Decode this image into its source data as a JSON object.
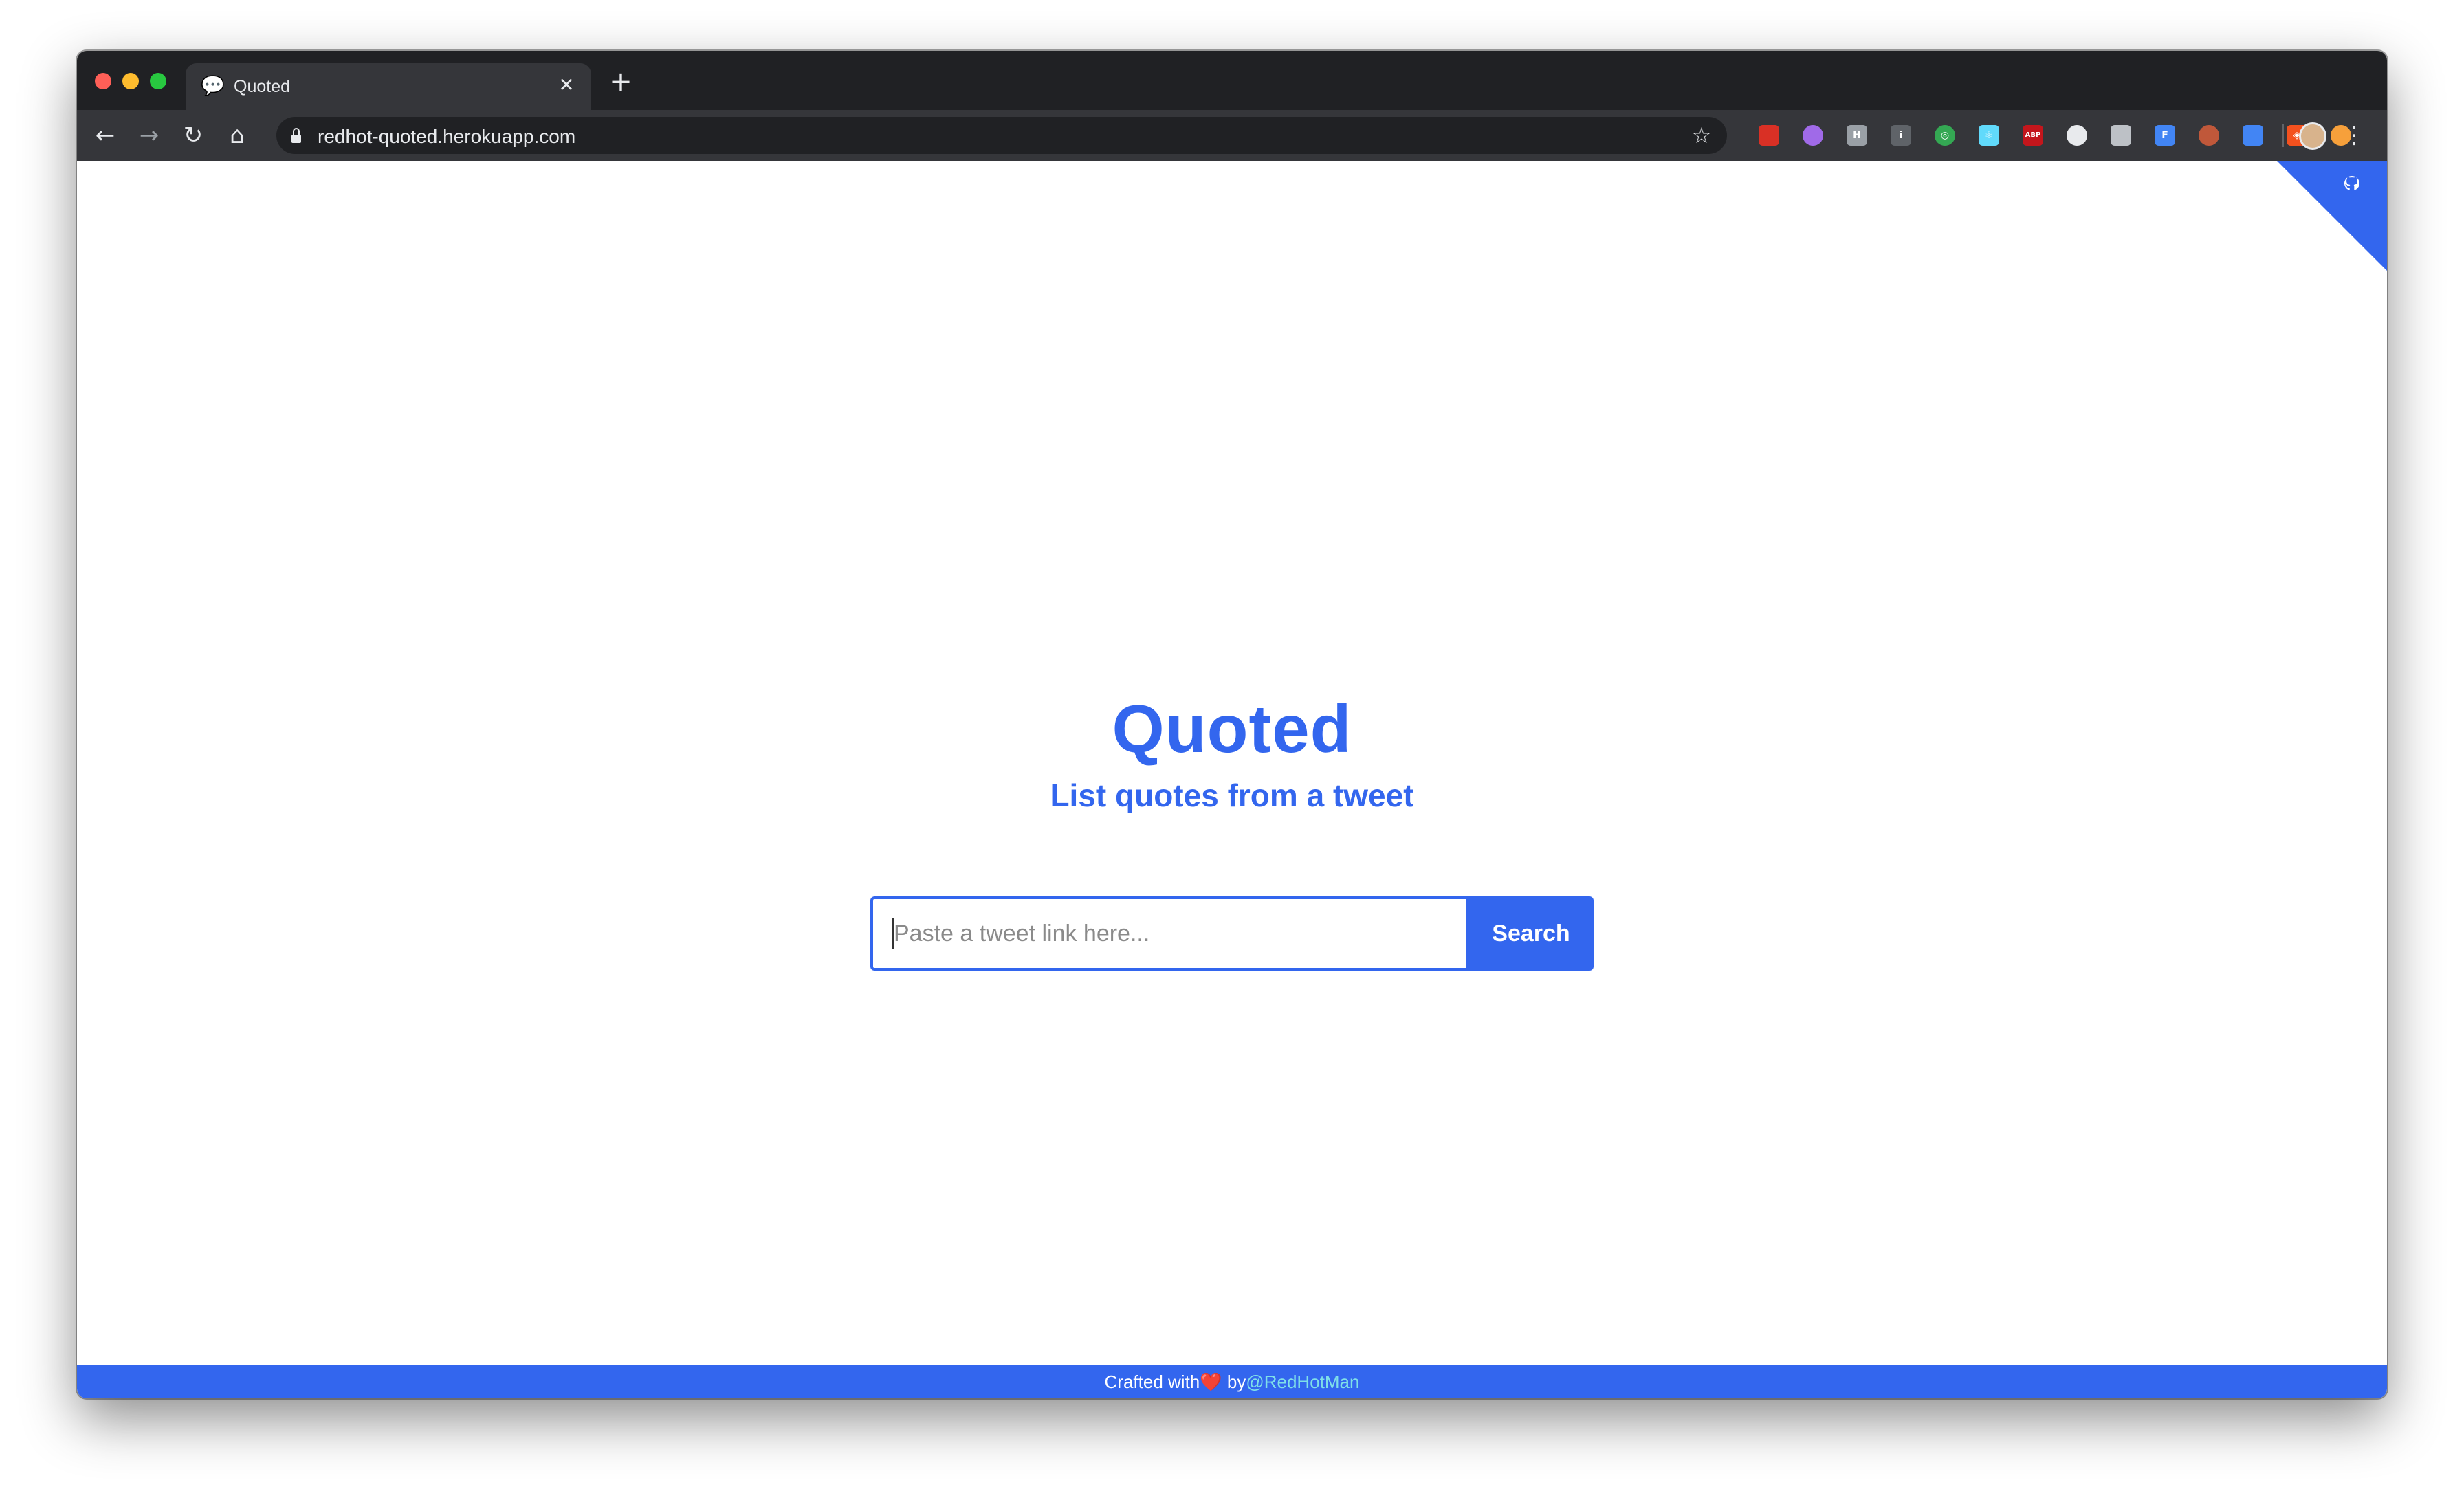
{
  "browser": {
    "tab": {
      "favicon": "speech-bubble-icon",
      "title": "Quoted",
      "close_glyph": "✕"
    },
    "new_tab_glyph": "+",
    "toolbar": {
      "back_glyph": "←",
      "forward_glyph": "→",
      "reload_glyph": "↻",
      "home_glyph": "⌂",
      "url": "redhot-quoted.herokuapp.com",
      "bookmark_glyph": "☆",
      "menu_glyph": "⋮"
    },
    "extensions": [
      {
        "name": "ext-1-icon",
        "label": "",
        "color": "#d93025"
      },
      {
        "name": "ext-2-icon",
        "label": "",
        "color": "#a06ae8"
      },
      {
        "name": "ext-3-icon",
        "label": "H",
        "color": "#9aa0a6"
      },
      {
        "name": "ext-4-icon",
        "label": "i",
        "color": "#5f6368"
      },
      {
        "name": "ext-5-icon",
        "label": "◎",
        "color": "#34a853"
      },
      {
        "name": "ext-6-icon",
        "label": "⚛",
        "color": "#61dafb"
      },
      {
        "name": "ext-7-icon",
        "label": "ABP",
        "color": "#c4161c"
      },
      {
        "name": "ext-8-icon",
        "label": "",
        "color": "#e8eaed"
      },
      {
        "name": "ext-9-icon",
        "label": "",
        "color": "#bdc1c6"
      },
      {
        "name": "ext-10-icon",
        "label": "F",
        "color": "#4285f4"
      },
      {
        "name": "ext-11-icon",
        "label": "",
        "color": "#c0583a"
      },
      {
        "name": "ext-12-icon",
        "label": "",
        "color": "#4285f4"
      },
      {
        "name": "ext-13-icon",
        "label": "◈",
        "color": "#f4511e"
      },
      {
        "name": "ext-14-icon",
        "label": "",
        "color": "#f6a03b"
      }
    ]
  },
  "page": {
    "title": "Quoted",
    "subtitle": "List quotes from a tweet",
    "search": {
      "placeholder": "Paste a tweet link here...",
      "value": "",
      "button_label": "Search"
    },
    "corner_icon": "github-octocat-icon",
    "footer": {
      "prefix": "Crafted with",
      "heart": "❤️",
      "by": " by",
      "author": "@RedHotMan"
    }
  },
  "colors": {
    "accent": "#3366ee",
    "frame_dark": "#202124",
    "toolbar": "#35363a"
  }
}
